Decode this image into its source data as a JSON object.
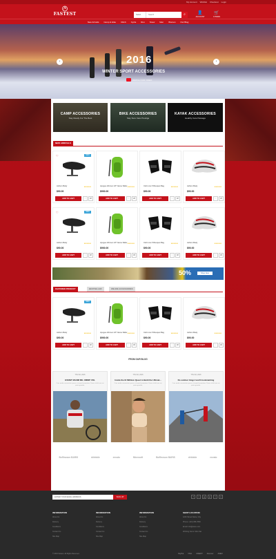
{
  "header": {
    "top_links": [
      "My Account",
      "Wishlist",
      "Checkout",
      "Login"
    ],
    "logo": "FASTEST",
    "search": {
      "category": "Select",
      "placeholder": "Search",
      "button": "⌕"
    },
    "account_label": "ACCOUNT",
    "cart_label": "0 ITEMS"
  },
  "nav": [
    "New Arrivals",
    "Camp & Hike",
    "Climb",
    "Cycle",
    "Run",
    "Snow",
    "Men",
    "Women",
    "Our Blog"
  ],
  "hero": {
    "year": "2016",
    "subtitle": "WINTER SPORT ACCESSORIES",
    "watch": "WATCH OUR VIDEO",
    "prev": "‹",
    "next": "›"
  },
  "promos": [
    {
      "title": "CAMP ACCESSORIES",
      "sub": "Stay Ready For The Best"
    },
    {
      "title": "BIKE ACCESSORIES",
      "sub": "Stay Sure Care Prestige"
    },
    {
      "title": "KAYAK ACCESSORIES",
      "sub": "Healthy Care Passage"
    }
  ],
  "new_arrivals": {
    "title": "NEW ARRIVALS",
    "rows": [
      [
        {
          "name": "Ashton Body",
          "price": "$90.00",
          "stars": "★★★★★",
          "add": "ADD TO CART",
          "new": "NEW"
        },
        {
          "name": "Apogee Women 18\" Name Slider",
          "price": "$900.00",
          "stars": "★★★★★",
          "add": "ADD TO CART"
        },
        {
          "name": "Club Line 5 Bouquet Bag",
          "price": "$90.00",
          "stars": "★★★★★",
          "add": "ADD TO CART"
        },
        {
          "name": "Ashton Body",
          "price": "$90.00",
          "stars": "★★★★★",
          "add": "ADD TO CART"
        }
      ],
      [
        {
          "name": "Ashton Body",
          "price": "$90.00",
          "stars": "★★★★★",
          "add": "ADD TO CART",
          "new": "NEW"
        },
        {
          "name": "Apogee Women 18\" Name Slider",
          "price": "$900.00",
          "stars": "★★★★★",
          "add": "ADD TO CART"
        },
        {
          "name": "Club Line 5 Bouquet Bag",
          "price": "$90.00",
          "stars": "★★★★★",
          "add": "ADD TO CART"
        },
        {
          "name": "Ashton Body",
          "price": "$90.00",
          "stars": "★★★★★",
          "add": "ADD TO CART"
        }
      ]
    ]
  },
  "banner": {
    "percent": "50%",
    "button": "Shop Now"
  },
  "tabs": [
    "FEATURED PRODUCT",
    "BESTSELLER",
    "ONLINE ACCESSORIES"
  ],
  "featured": [
    {
      "name": "Ashton Body",
      "price": "$90.00",
      "stars": "★★★★★",
      "add": "ADD TO CART",
      "new": "NEW"
    },
    {
      "name": "Apogee Women 18\" Name Slider",
      "price": "$900.00",
      "stars": "★★★★★",
      "add": "ADD TO CART"
    },
    {
      "name": "Club Line 5 Bouquet Bag",
      "price": "$90.00",
      "stars": "★★★★★",
      "add": "ADD TO CART"
    },
    {
      "name": "Ashton Body",
      "price": "$90.00",
      "stars": "★★★★★",
      "add": "ADD TO CART"
    }
  ],
  "blog": {
    "title": "FROM OUR BLOG",
    "posts": [
      {
        "date": "THU 02, 2016",
        "title": "EVENIT MAXIM MIL OMNIP VOL",
        "text": "Cras mattis consectetur purus sit amet fermentum. Donec id elit non mi porta gravida."
      },
      {
        "date": "THU 02, 2016",
        "title": "Inside the El Millitom Quest to Build the Ultimat...",
        "text": "Cras mattis consectetur purus sit amet fermentum. Donec id elit non mi porta gravida."
      },
      {
        "date": "THU 02, 2016",
        "title": "No outdoor blogs! worth bookmarking",
        "text": "Cras mattis consectetur purus sit amet fermentum. Donec id elit non mi porta gravida."
      }
    ]
  },
  "brands": [
    "Boffinoson BARIS",
    "dribbble",
    "envato",
    "Microsoft",
    "Boffinoson BARIS",
    "dribbble",
    "envato"
  ],
  "footer": {
    "newsletter_placeholder": "ENTER YOUR EMAIL ADDRESS",
    "subscribe": "SIGN UP",
    "social": [
      "f",
      "t",
      "g",
      "p",
      "t",
      "v"
    ],
    "columns": [
      {
        "title": "INFORMATION",
        "items": [
          "About Us",
          "Delivery",
          "Conditions",
          "Contact Us",
          "Site Map"
        ]
      },
      {
        "title": "INFORMATION",
        "items": [
          "About Us",
          "Delivery",
          "Conditions",
          "Contact Us",
          "Site Map"
        ]
      },
      {
        "title": "INFORMATION",
        "items": [
          "About Us",
          "Delivery",
          "Conditions",
          "Contact Us",
          "Site Map"
        ]
      },
      {
        "title": "SHOP LOCATION",
        "items": [
          "1234 Street Name, City",
          "Phone: (123) 456-7890",
          "Email: info@store.com",
          "Working hours: Mon-Sat"
        ]
      }
    ],
    "copyright": "© 2016 Fastest. All Rights Reserved.",
    "payments": [
      "PayPal",
      "VISA",
      "CREDIT",
      "discover",
      "AMEX"
    ]
  },
  "colors": {
    "brand": "#c4121b",
    "star": "#f3b800",
    "new_badge": "#3aa4d8"
  }
}
